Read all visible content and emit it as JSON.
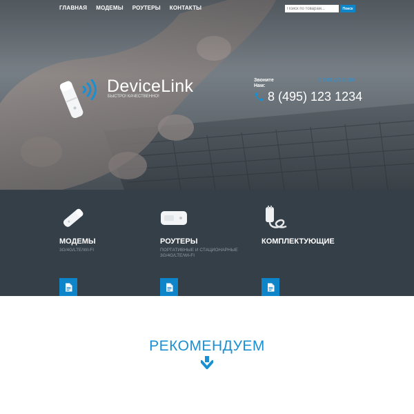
{
  "nav": {
    "items": [
      {
        "label": "ГЛАВНАЯ"
      },
      {
        "label": "МОДЕМЫ"
      },
      {
        "label": "РОУТЕРЫ"
      },
      {
        "label": "КОНТАКТЫ"
      }
    ]
  },
  "search": {
    "placeholder": "Поиск по товарам...",
    "button_label": "Поиск"
  },
  "brand": {
    "name": "DeviceLink",
    "tagline": "БЫСТРО! КАЧЕСТВЕННО!"
  },
  "contact": {
    "call_label": "Звоните Нам:",
    "hours": "С 9:00 ДО 21:00",
    "phone": "8 (495) 123 1234"
  },
  "categories": [
    {
      "title": "МОДЕМЫ",
      "subtitle": "3G/4G/LTE/WI-FI",
      "icon": "document-icon"
    },
    {
      "title": "РОУТЕРЫ",
      "subtitle": "ПОРТАТИВНЫЕ И СТАЦИОНАРНЫЕ 3G/4G/LTE/WI-FI",
      "icon": "document-icon"
    },
    {
      "title": "КОМПЛЕКТУЮЩИЕ",
      "subtitle": "",
      "icon": "document-icon"
    }
  ],
  "recommend": {
    "title": "РЕКОМЕНДУЕМ"
  },
  "colors": {
    "accent": "#0f85c9",
    "band": "#353f48",
    "heading_blue": "#1a8fd1"
  }
}
